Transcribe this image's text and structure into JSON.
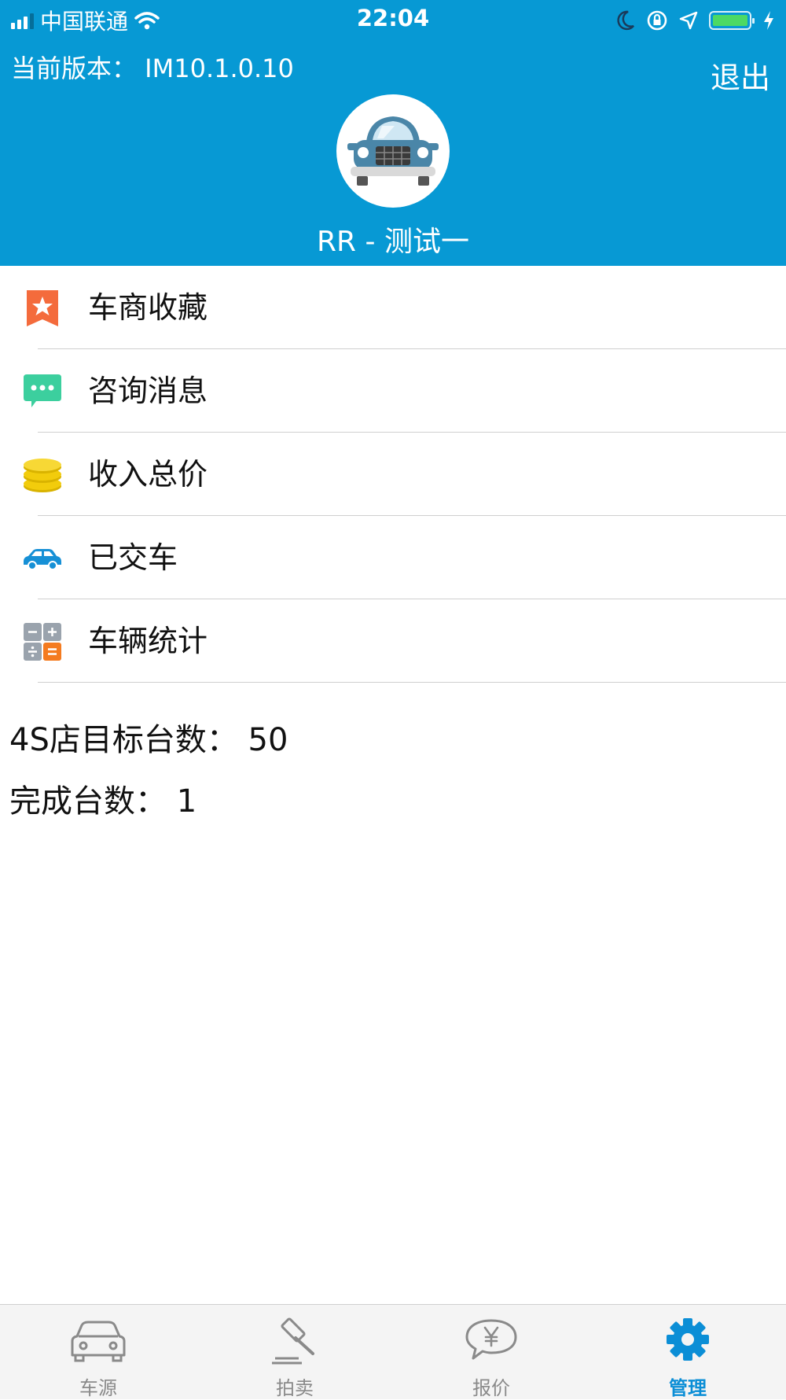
{
  "status_bar": {
    "carrier": "中国联通",
    "time": "22:04",
    "battery_level": 1.0
  },
  "header": {
    "version": "当前版本：  IM10.1.0.10",
    "logout_label": "退出",
    "username": "RR - 测试一",
    "bg_color": "#0799d4"
  },
  "menu": {
    "items": [
      {
        "label": "车商收藏",
        "icon": "star-bookmark-icon"
      },
      {
        "label": "咨询消息",
        "icon": "chat-bubble-icon"
      },
      {
        "label": "收入总价",
        "icon": "coins-icon"
      },
      {
        "label": "已交车",
        "icon": "car-icon"
      },
      {
        "label": "车辆统计",
        "icon": "calculator-icon"
      }
    ]
  },
  "stats": {
    "target": "4S店目标台数：  50",
    "completed": "完成台数：  1"
  },
  "tabbar": {
    "tabs": [
      {
        "label": "车源",
        "icon": "car-outline-icon"
      },
      {
        "label": "拍卖",
        "icon": "gavel-icon"
      },
      {
        "label": "报价",
        "icon": "yen-bubble-icon"
      },
      {
        "label": "管理",
        "icon": "gear-icon"
      }
    ],
    "active_index": 3,
    "active_color": "#0b8ed6",
    "inactive_color": "#8a8a8a"
  }
}
